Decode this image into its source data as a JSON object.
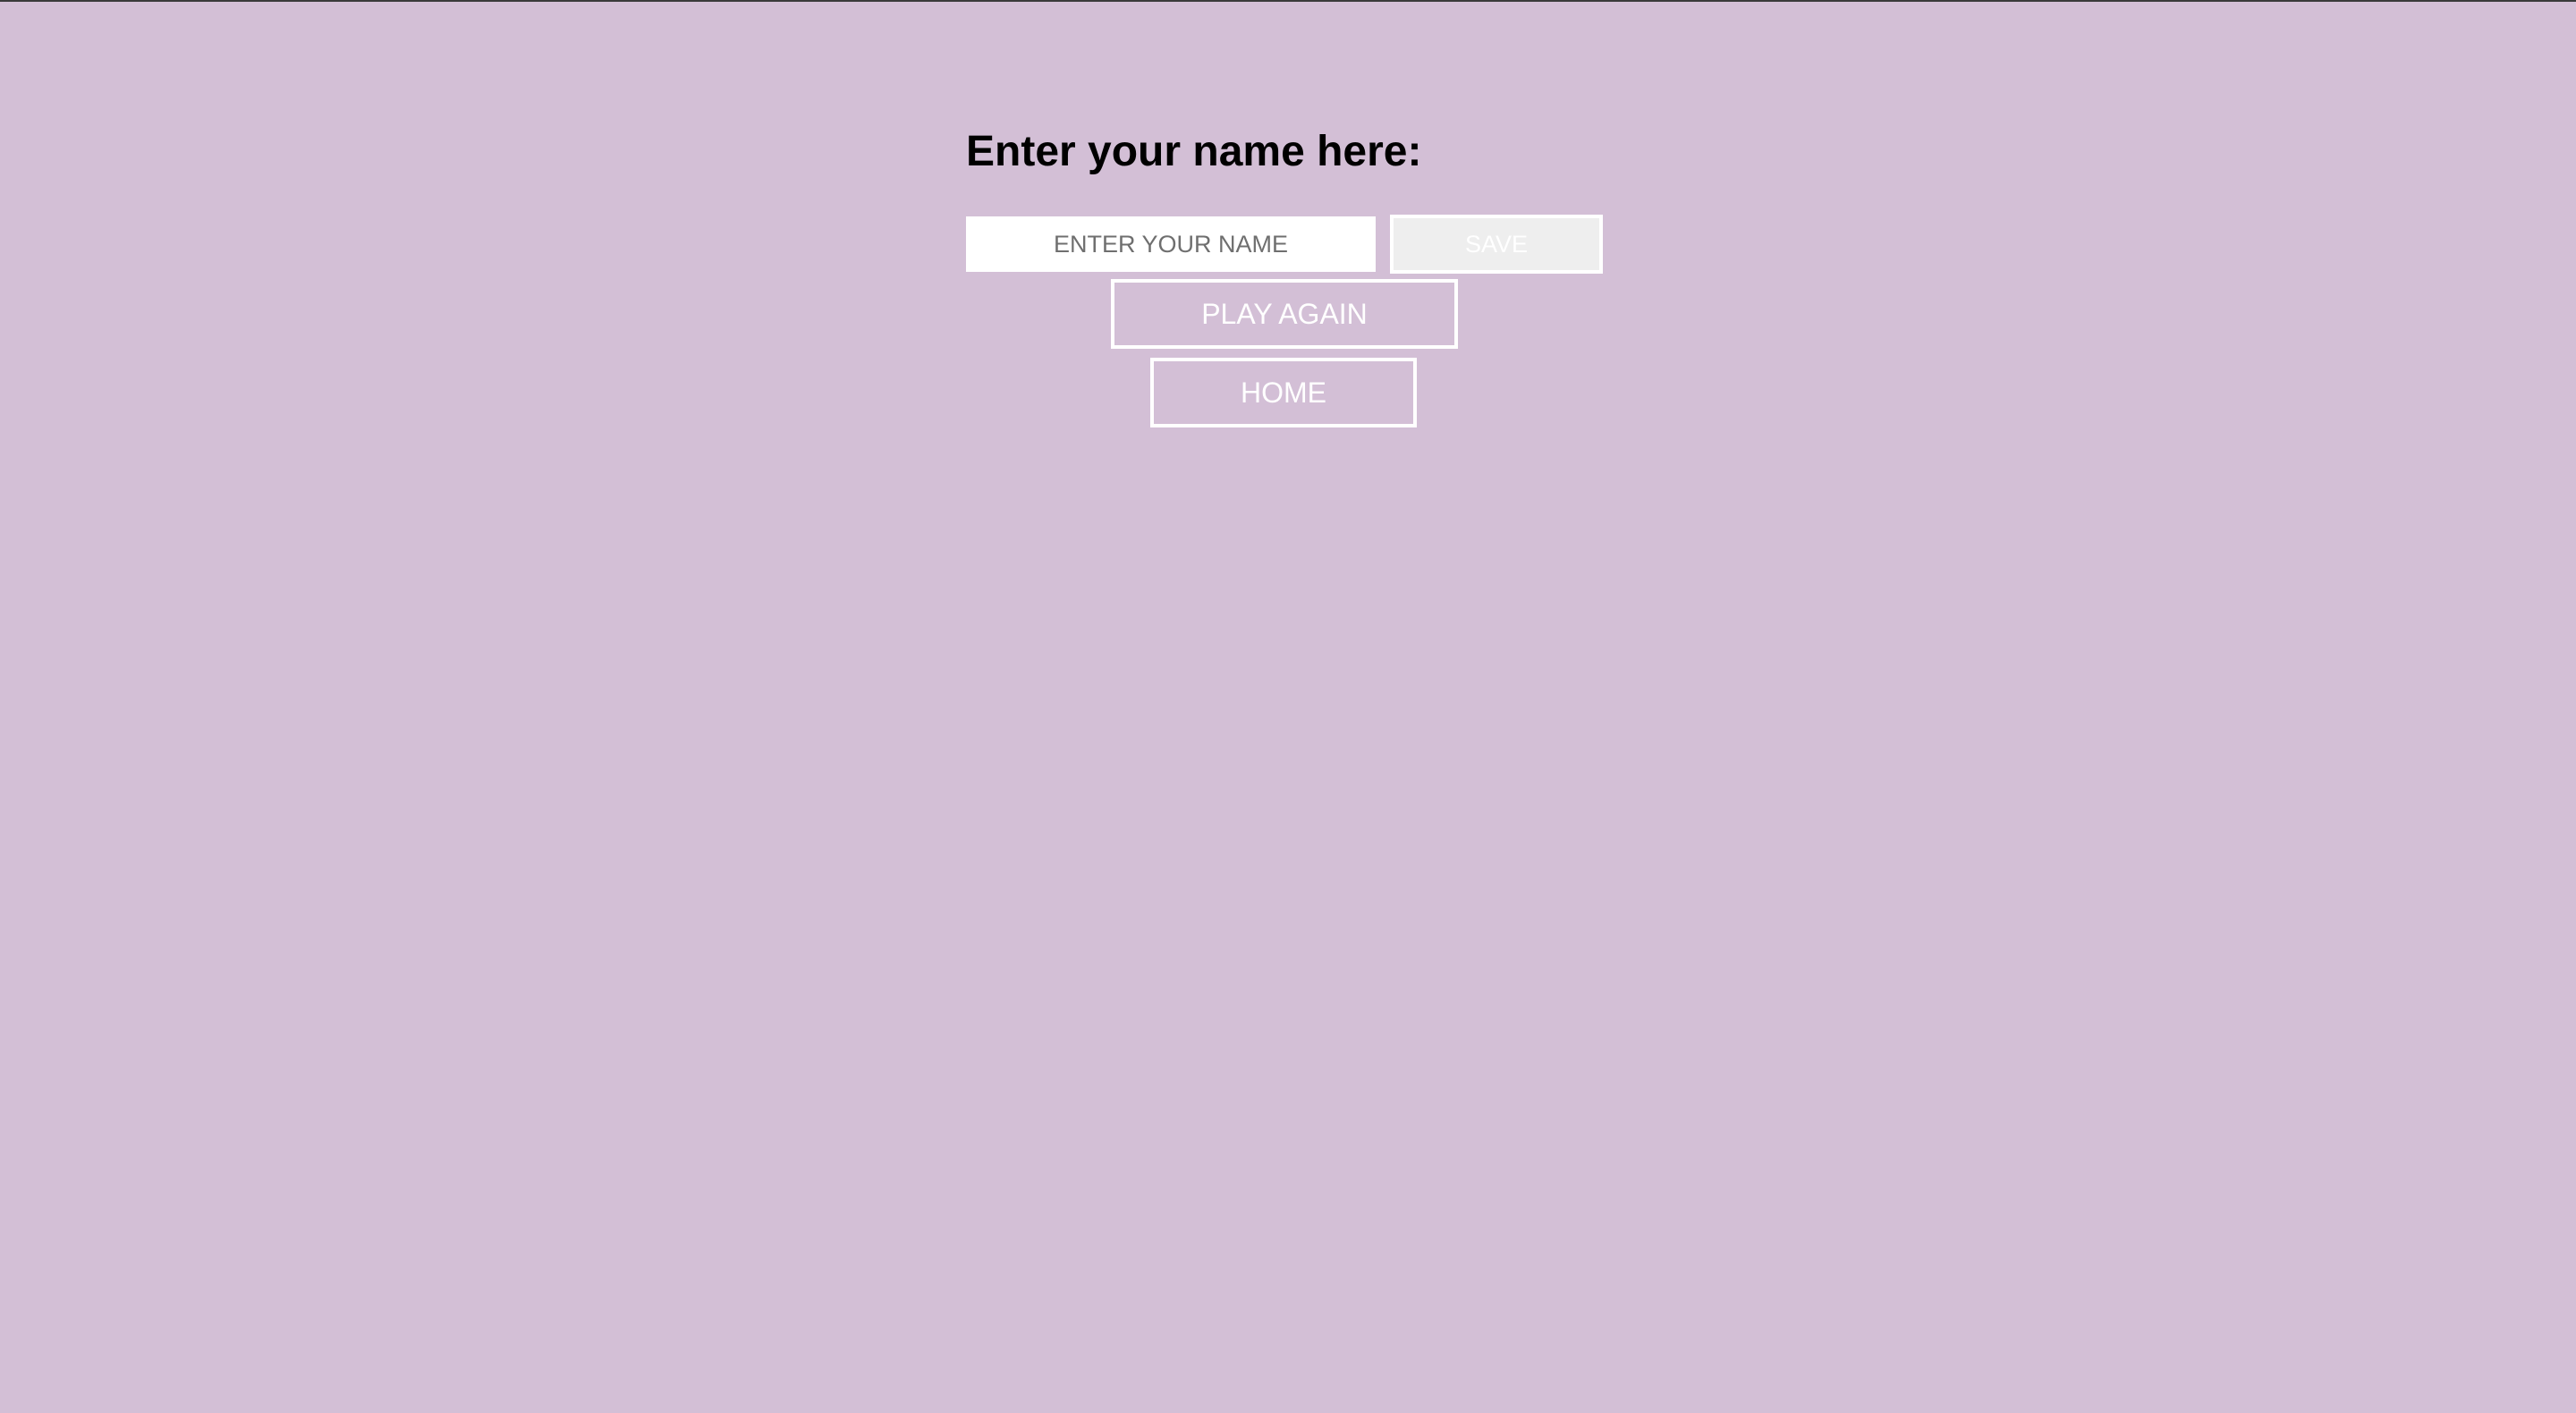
{
  "page": {
    "background_color": "#d3bfd6",
    "accent_color": "#ffffff"
  },
  "form": {
    "title": "Enter your name here:",
    "name_input": {
      "value": "",
      "placeholder": "ENTER YOUR NAME"
    },
    "save_label": "SAVE"
  },
  "actions": {
    "play_again_label": "PLAY AGAIN",
    "home_label": "HOME"
  }
}
